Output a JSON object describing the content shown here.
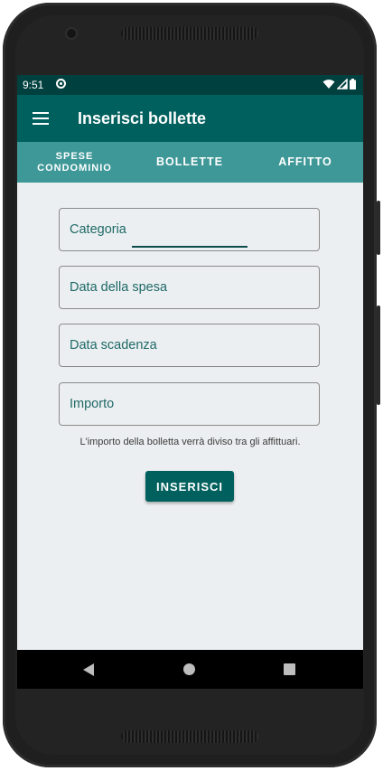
{
  "status_bar": {
    "time": "9:51",
    "icons": [
      "sync-icon",
      "wifi-icon",
      "signal-icon",
      "battery-icon"
    ]
  },
  "app_bar": {
    "title": "Inserisci bollette",
    "menu_icon": "hamburger-menu-icon"
  },
  "tabs": [
    {
      "label_line1": "SPESE",
      "label_line2": "CONDOMINIO",
      "selected": false
    },
    {
      "label": "BOLLETTE",
      "selected": true
    },
    {
      "label": "AFFITTO",
      "selected": false
    }
  ],
  "form": {
    "category_placeholder": "Categoria",
    "expense_date_placeholder": "Data della spesa",
    "due_date_placeholder": "Data scadenza",
    "amount_placeholder": "Importo",
    "helper_text": "L'importo della bolletta verrà diviso tra gli affittuari.",
    "submit_label": "INSERISCI"
  },
  "navigation": {
    "back": "back-icon",
    "home": "home-icon",
    "recents": "recents-icon"
  },
  "colors": {
    "status_bar": "#00403f",
    "app_bar": "#00605e",
    "tab_bar": "#3f9898",
    "background": "#eceff1",
    "button": "#00605e"
  }
}
